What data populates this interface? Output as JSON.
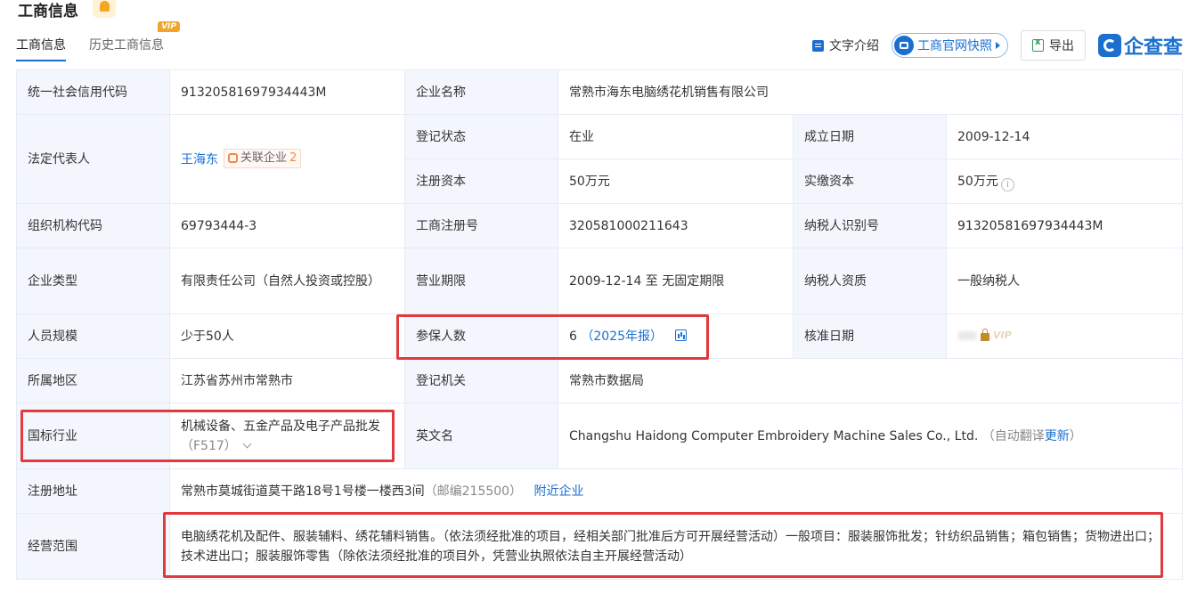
{
  "header": {
    "title": "工商信息",
    "bell_icon": "bell-icon"
  },
  "tabs": [
    {
      "label": "工商信息",
      "active": true
    },
    {
      "label": "历史工商信息",
      "badge": "VIP"
    }
  ],
  "toolbar": {
    "text_intro": "文字介绍",
    "snapshot": "工商官网快照",
    "export": "导出",
    "brand": "企查查"
  },
  "rows": {
    "credit_code": {
      "label": "统一社会信用代码",
      "value": "91320581697934443M"
    },
    "company_name": {
      "label": "企业名称",
      "value": "常熟市海东电脑绣花机销售有限公司"
    },
    "legal_rep": {
      "label": "法定代表人",
      "value": "王海东",
      "related_label": "关联企业",
      "related_count": "2"
    },
    "reg_status": {
      "label": "登记状态",
      "value": "在业"
    },
    "found_date": {
      "label": "成立日期",
      "value": "2009-12-14"
    },
    "reg_capital": {
      "label": "注册资本",
      "value": "50万元"
    },
    "paid_capital": {
      "label": "实缴资本",
      "value": "50万元"
    },
    "org_code": {
      "label": "组织机构代码",
      "value": "69793444-3"
    },
    "biz_reg_no": {
      "label": "工商注册号",
      "value": "320581000211643"
    },
    "taxpayer_id": {
      "label": "纳税人识别号",
      "value": "91320581697934443M"
    },
    "company_type": {
      "label": "企业类型",
      "value": "有限责任公司（自然人投资或控股）"
    },
    "biz_term": {
      "label": "营业期限",
      "value": "2009-12-14 至 无固定期限"
    },
    "taxpayer_qual": {
      "label": "纳税人资质",
      "value": "一般纳税人"
    },
    "staff_size": {
      "label": "人员规模",
      "value": "少于50人"
    },
    "insured": {
      "label": "参保人数",
      "value": "6",
      "report": "（2025年报）"
    },
    "approval_date": {
      "label": "核准日期",
      "vip": "VIP"
    },
    "region": {
      "label": "所属地区",
      "value": "江苏省苏州市常熟市"
    },
    "reg_authority": {
      "label": "登记机关",
      "value": "常熟市数据局"
    },
    "industry": {
      "label": "国标行业",
      "value": "机械设备、五金产品及电子产品批发",
      "code": "（F517）"
    },
    "english_name": {
      "label": "英文名",
      "value": "Changshu Haidong Computer Embroidery Machine Sales Co., Ltd.",
      "note_prefix": "（自动翻译",
      "note_link": "更新",
      "note_suffix": "）"
    },
    "address": {
      "label": "注册地址",
      "value": "常熟市莫城街道莫干路18号1号楼一楼西3间",
      "postcode": "（邮编215500）",
      "nearby": "附近企业"
    },
    "biz_scope": {
      "label": "经营范围",
      "value": "电脑绣花机及配件、服装辅料、绣花辅料销售。（依法须经批准的项目，经相关部门批准后方可开展经营活动）一般项目：服装服饰批发；针纺织品销售；箱包销售；货物进出口；技术进出口；服装服饰零售（除依法须经批准的项目外，凭营业执照依法自主开展经营活动）"
    }
  },
  "colors": {
    "accent": "#1a6fcf",
    "label_bg": "#f3f7fd",
    "highlight": "#e0393e",
    "related": "#f08a4b"
  }
}
